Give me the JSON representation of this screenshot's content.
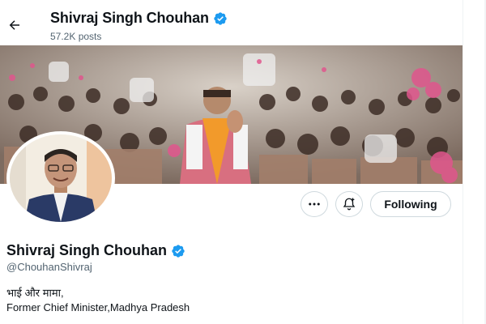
{
  "header": {
    "title": "Shivraj Singh Chouhan",
    "posts_count": "57.2K posts"
  },
  "actions": {
    "follow_label": "Following"
  },
  "profile": {
    "display_name": "Shivraj Singh Chouhan",
    "handle": "@ChouhanShivraj",
    "bio_line_1": "भाई और मामा,",
    "bio_line_2": "Former Chief Minister,Madhya Pradesh"
  },
  "icons": [
    "back-arrow-icon",
    "verified-badge-icon",
    "more-options-icon",
    "notification-bell-icon"
  ],
  "colors": {
    "verified_blue": "#1d9bf0",
    "text_primary": "#0f1419",
    "text_secondary": "#536471",
    "border": "#cfd9de"
  }
}
